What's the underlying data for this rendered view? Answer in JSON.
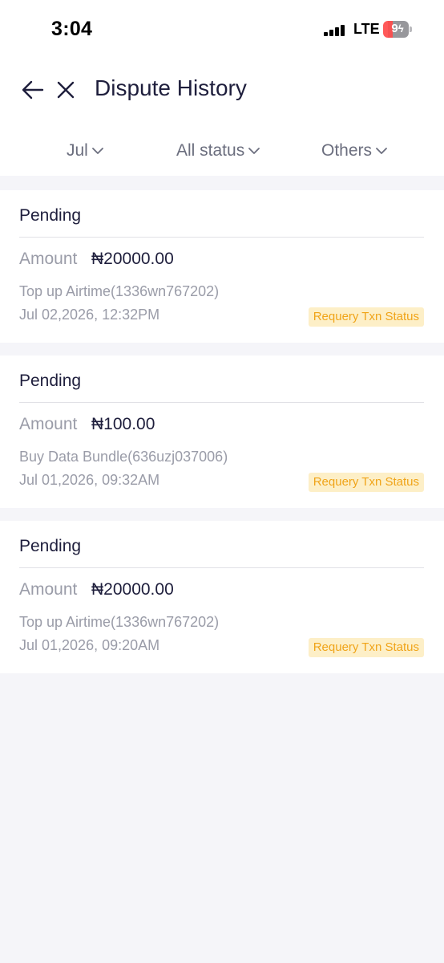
{
  "status_bar": {
    "time": "3:04",
    "network": "LTE",
    "battery": "9"
  },
  "nav": {
    "title": "Dispute History",
    "back_icon": "arrow-left-icon",
    "close_icon": "close-icon"
  },
  "filters": [
    {
      "label": "Jul",
      "icon": "chevron-down-icon"
    },
    {
      "label": "All status",
      "icon": "chevron-down-icon"
    },
    {
      "label": "Others",
      "icon": "chevron-down-icon"
    }
  ],
  "disputes": [
    {
      "status": "Pending",
      "amount_label": "Amount",
      "amount": "₦20000.00",
      "description": "Top up Airtime(1336wn767202)",
      "date": "Jul 02,2026, 12:32PM",
      "action": "Requery Txn Status"
    },
    {
      "status": "Pending",
      "amount_label": "Amount",
      "amount": "₦100.00",
      "description": "Buy Data Bundle(636uzj037006)",
      "date": "Jul 01,2026, 09:32AM",
      "action": "Requery Txn Status"
    },
    {
      "status": "Pending",
      "amount_label": "Amount",
      "amount": "₦20000.00",
      "description": "Top up Airtime(1336wn767202)",
      "date": "Jul 01,2026, 09:20AM",
      "action": "Requery Txn Status"
    }
  ],
  "colors": {
    "background": "#f5f5f9",
    "title": "#1e1e3c",
    "muted": "#9a9ca8",
    "badge_bg": "#fdefc7",
    "badge_text": "#f0a419"
  }
}
